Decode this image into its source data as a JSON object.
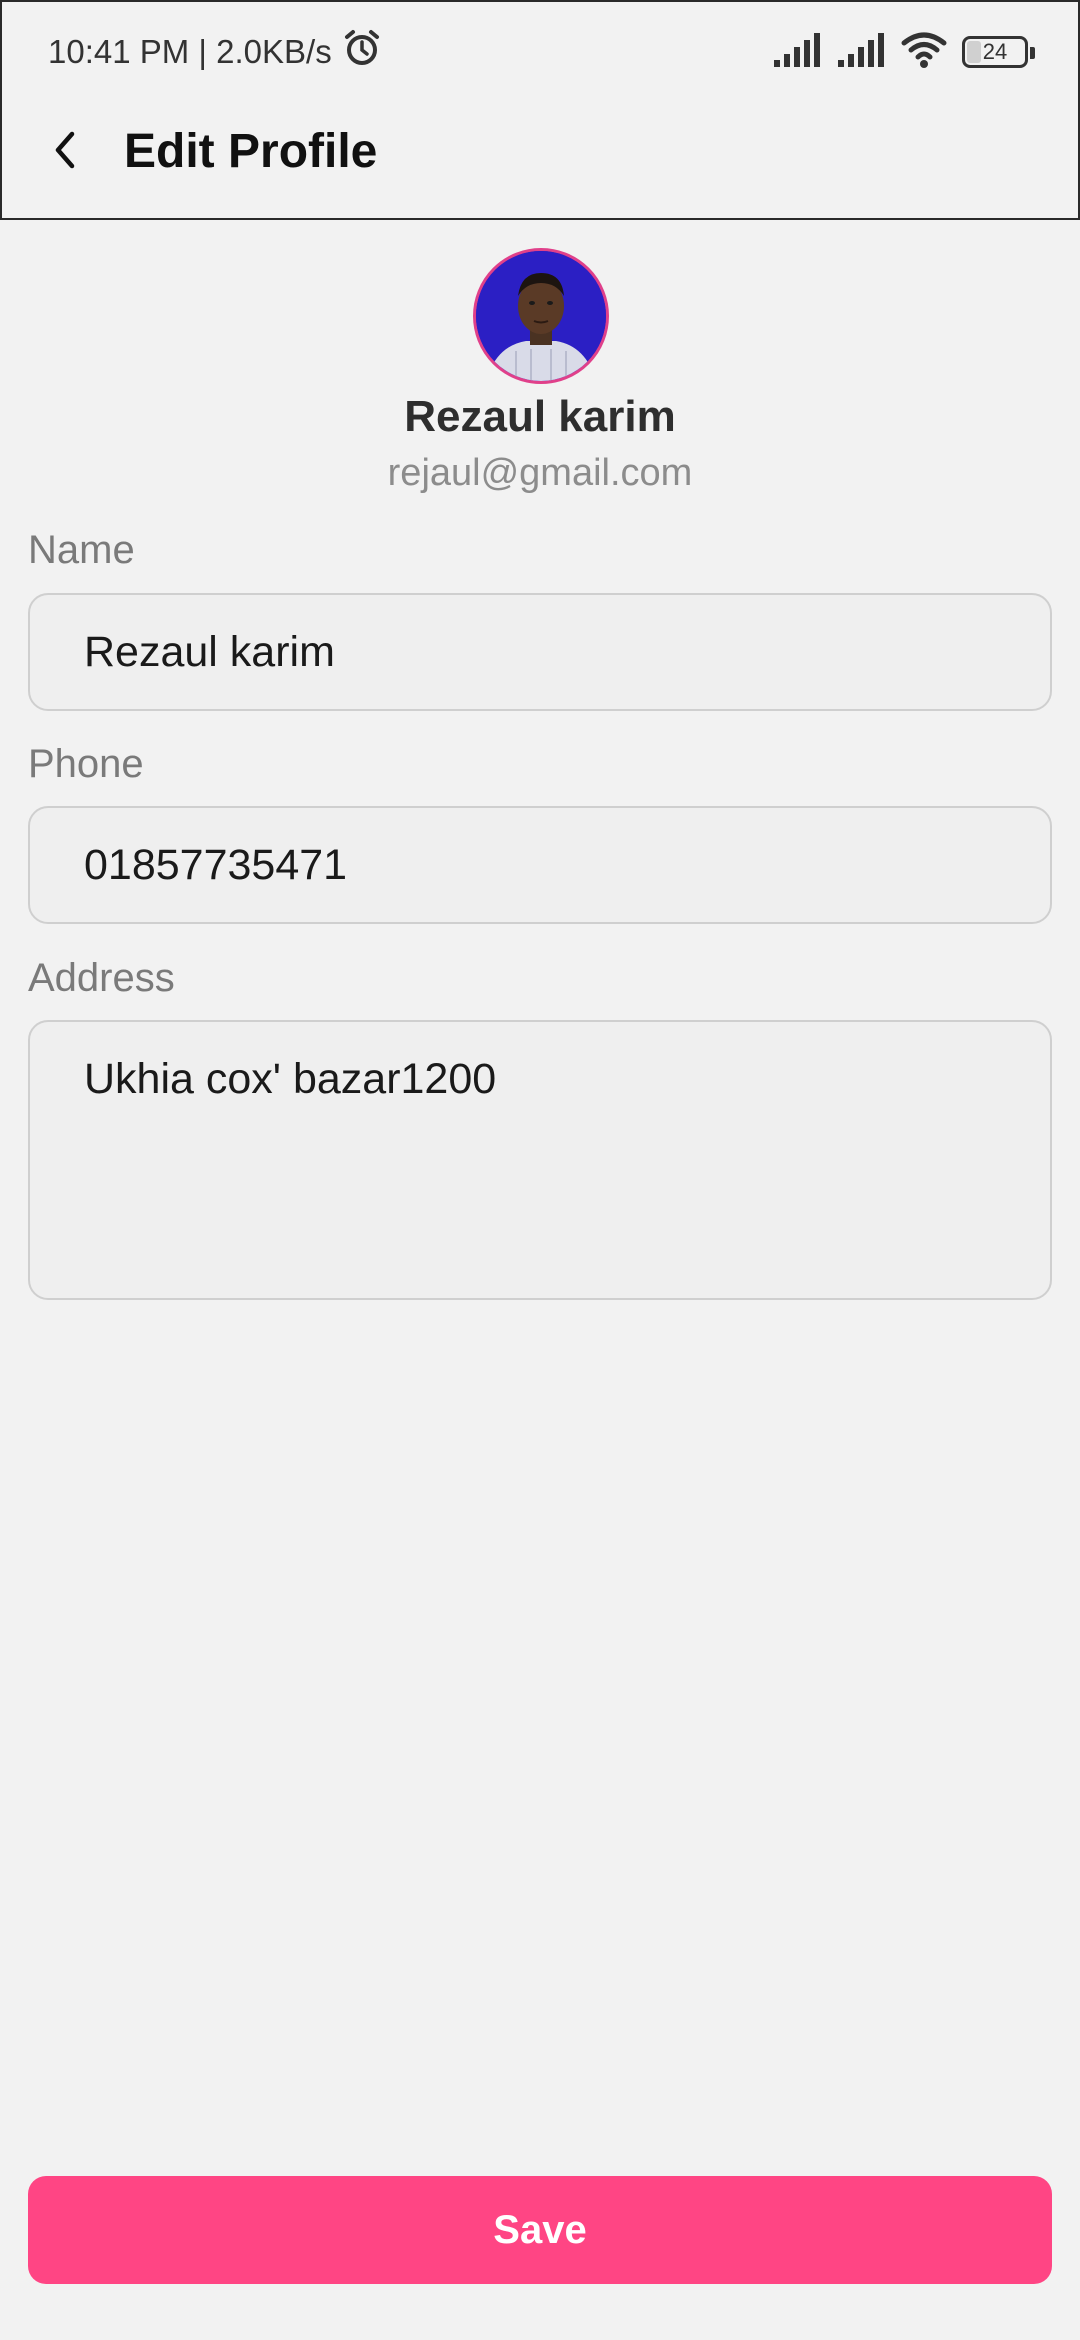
{
  "status_bar": {
    "time_speed": "10:41 PM | 2.0KB/s",
    "battery_level": "24",
    "battery_fraction": 0.24,
    "icons": [
      "alarm-icon",
      "signal-icon",
      "signal-icon",
      "wifi-icon",
      "battery-icon"
    ]
  },
  "app_bar": {
    "title": "Edit Profile",
    "back_icon": "chevron-left-icon"
  },
  "profile": {
    "name": "Rezaul karim",
    "email": "rejaul@gmail.com",
    "avatar_ring_color": "#e0408a",
    "avatar_bg_color": "#2b1fc4"
  },
  "form": {
    "name_label": "Name",
    "name_value": "Rezaul karim",
    "phone_label": "Phone",
    "phone_value": "01857735471",
    "address_label": "Address",
    "address_value": "Ukhia cox' bazar1200"
  },
  "save_button": {
    "label": "Save",
    "color": "#ff4584"
  }
}
